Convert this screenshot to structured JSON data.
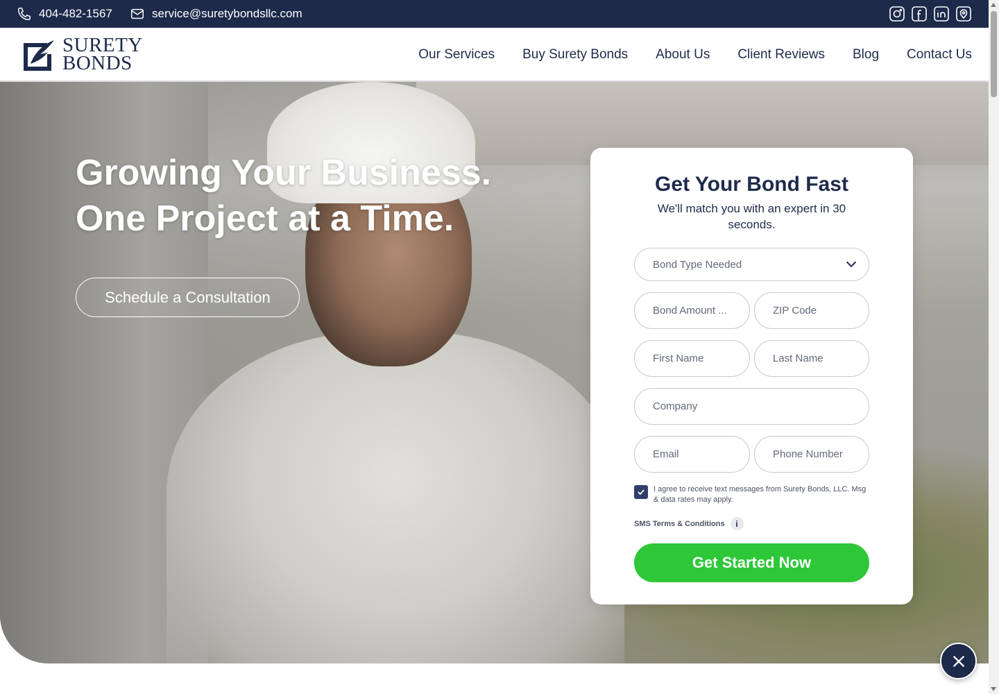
{
  "topbar": {
    "phone": "404-482-1567",
    "email": "service@suretybondsllc.com",
    "socials": [
      "instagram-icon",
      "facebook-icon",
      "linkedin-icon",
      "location-pin-icon"
    ]
  },
  "logo": {
    "line1": "SURETY",
    "line2": "BONDS"
  },
  "nav": {
    "items": [
      "Our Services",
      "Buy Surety Bonds",
      "About Us",
      "Client Reviews",
      "Blog",
      "Contact Us"
    ]
  },
  "hero": {
    "headline_line1": "Growing Your Business.",
    "headline_line2": "One Project at a Time.",
    "cta_label": "Schedule a Consultation"
  },
  "form": {
    "title": "Get Your Bond Fast",
    "subtitle": "We'll match you with an expert in 30 seconds.",
    "bond_type_placeholder": "Bond Type Needed",
    "bond_amount_placeholder": "Bond Amount ...",
    "zip_placeholder": "ZIP Code",
    "first_name_placeholder": "First Name",
    "last_name_placeholder": "Last Name",
    "company_placeholder": "Company",
    "email_placeholder": "Email",
    "phone_placeholder": "Phone Number",
    "consent_checked": true,
    "consent_text": "I agree to receive text messages from Surety Bonds, LLC. Msg & data rates may apply.",
    "sms_terms_label": "SMS Terms & Conditions",
    "info_icon_glyph": "i",
    "submit_label": "Get Started Now"
  },
  "colors": {
    "navy": "#1d2a4a",
    "green": "#2ec738"
  }
}
